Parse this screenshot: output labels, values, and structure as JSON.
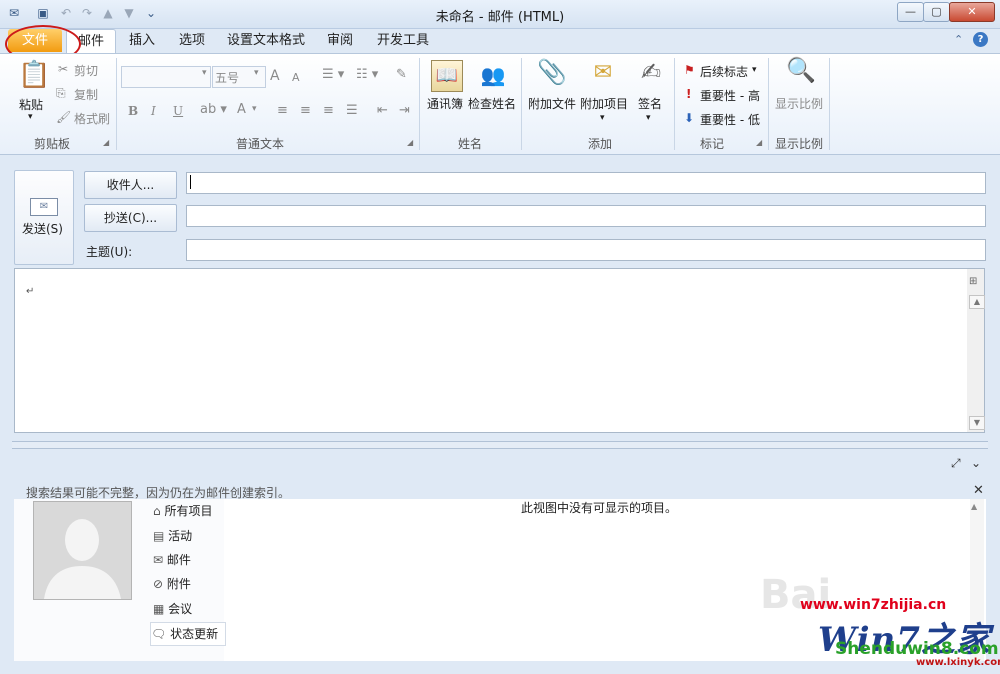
{
  "window": {
    "title": "未命名 - 邮件 (HTML)"
  },
  "window_controls": {
    "min": "—",
    "max": "▢",
    "close": "✕"
  },
  "tabs": [
    "文件",
    "邮件",
    "插入",
    "选项",
    "设置文本格式",
    "审阅",
    "开发工具"
  ],
  "ribbon": {
    "clipboard": {
      "paste": "粘贴",
      "cut": "剪切",
      "copy": "复制",
      "format_painter": "格式刷",
      "label": "剪贴板"
    },
    "text": {
      "font_size": "五号",
      "label": "普通文本",
      "bold": "B",
      "italic": "I",
      "underline": "U",
      "grow": "A",
      "shrink": "A",
      "font_color": "A"
    },
    "names": {
      "address_book": "通讯簿",
      "check_names": "检查姓名",
      "label": "姓名"
    },
    "include": {
      "attach_file": "附加文件",
      "attach_item": "附加项目",
      "signature": "签名",
      "label": "添加"
    },
    "tags": {
      "follow_up": "后续标志",
      "high_importance": "重要性 - 高",
      "low_importance": "重要性 - 低",
      "label": "标记"
    },
    "zoom": {
      "zoom": "显示比例",
      "label": "显示比例"
    }
  },
  "compose": {
    "send": "发送(S)",
    "to_button": "收件人...",
    "cc_button": "抄送(C)...",
    "subject_label": "主题(U):",
    "to_value": "",
    "cc_value": "",
    "subject_value": "",
    "body_mark": "↵"
  },
  "people_pane": {
    "search_notice": "搜索结果可能不完整，因为仍在为邮件创建索引。",
    "empty_message": "此视图中没有可显示的项目。",
    "nav": [
      "所有项目",
      "活动",
      "邮件",
      "附件",
      "会议",
      "状态更新"
    ]
  },
  "watermark": {
    "url1": "www.win7zhijia.cn",
    "logo": "Win7之家",
    "url2": "Shenduwin8.com",
    "url3": "www.lxinyk.com"
  },
  "colors": {
    "file_tab": "#f29b10",
    "highlight_circle": "#cc1a1a",
    "ribbon_bg": "#e8f0fa"
  }
}
